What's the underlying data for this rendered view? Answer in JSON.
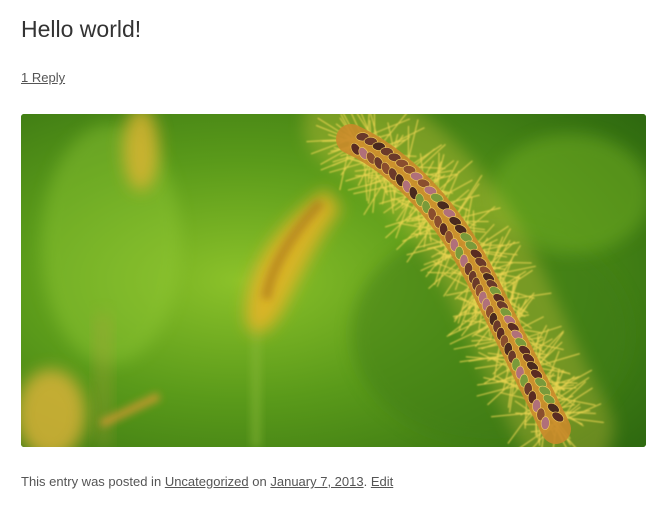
{
  "post": {
    "title": "Hello world!",
    "reply_link": "1 Reply",
    "image": {
      "subject": "foxtail-grass-seed-head",
      "colors": {
        "background": "#4a8a16",
        "highlight": "#9acd32",
        "spike": "#e8b830",
        "seed": "#6b3a2a"
      }
    },
    "meta": {
      "prefix": "This entry was posted in",
      "category": "Uncategorized",
      "on": "on",
      "date": "January 7, 2013",
      "separator": ".",
      "edit": "Edit"
    }
  }
}
